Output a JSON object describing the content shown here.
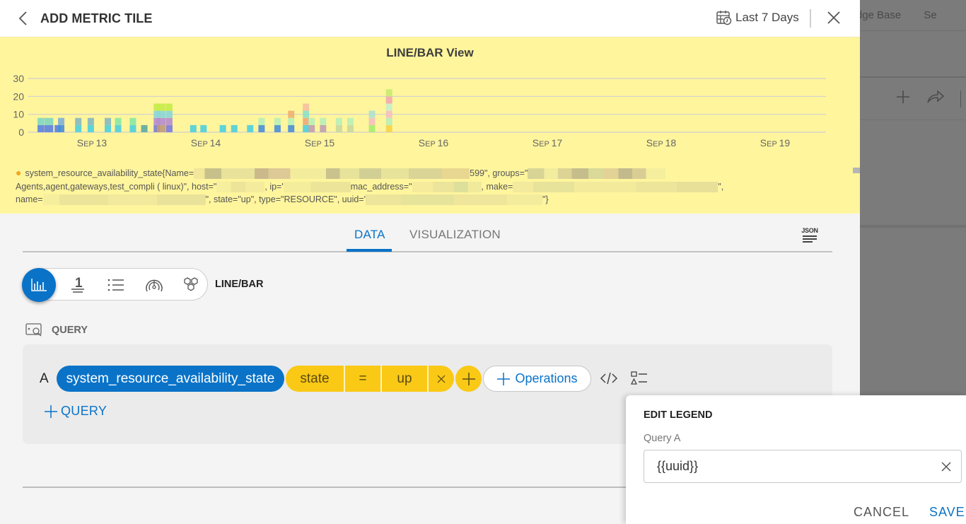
{
  "background_app": {
    "nav_items": [
      "owledge Base",
      "Se"
    ],
    "toolbar_icons": [
      "plus-icon",
      "share-icon"
    ]
  },
  "header": {
    "title": "ADD METRIC TILE",
    "time_range": "Last 7 Days",
    "back_icon": "chevron-left-icon",
    "calendar_icon": "calendar-clock-icon",
    "close_icon": "close-icon"
  },
  "preview": {
    "chart_title": "LINE/BAR View",
    "legend_lines": [
      {
        "prefix": "system_resource_availability_state{Name=",
        "mid1": "599\", groups=\"",
        "mid2": ""
      },
      {
        "prefix": "Agents,agent,gateways,test_compli ( linux)\", host=\"",
        "mid1": ", ip='",
        "mid2": "mac_address=\"",
        "mid3": ", make=",
        "end": "\","
      },
      {
        "prefix": "name=",
        "mid1": "\", state=\"up\", type=\"RESOURCE\", uuid='",
        "end": "\"}"
      }
    ]
  },
  "chart_data": {
    "type": "bar",
    "title": "LINE/BAR View",
    "xlabel": "",
    "ylabel": "",
    "ylim": [
      0,
      30
    ],
    "yticks": [
      0,
      10,
      20,
      30
    ],
    "xticks": [
      "Sep 13",
      "Sep 14",
      "Sep 15",
      "Sep 16",
      "Sep 17",
      "Sep 18",
      "Sep 19"
    ],
    "grid": true,
    "stacked": true,
    "note": "Stacked bars of series count per time bucket; approximate heights read from gridlines",
    "bars": [
      {
        "day": 12.55,
        "segments": [
          {
            "value": 4,
            "color": "#5c7fe0"
          },
          {
            "value": 4,
            "color": "#7fd6c2"
          }
        ]
      },
      {
        "day": 12.62,
        "segments": [
          {
            "value": 4,
            "color": "#5c7fe0"
          },
          {
            "value": 4,
            "color": "#7fd6c2"
          }
        ]
      },
      {
        "day": 12.7,
        "segments": [
          {
            "value": 4,
            "color": "#5c7fe0"
          }
        ]
      },
      {
        "day": 12.73,
        "segments": [
          {
            "value": 4,
            "color": "#4a8ed8"
          },
          {
            "value": 4,
            "color": "#7fb0d8"
          }
        ]
      },
      {
        "day": 12.88,
        "segments": [
          {
            "value": 4,
            "color": "#4ccfdf"
          },
          {
            "value": 4,
            "color": "#86b8c3"
          }
        ]
      },
      {
        "day": 12.99,
        "segments": [
          {
            "value": 4,
            "color": "#4ccfdf"
          },
          {
            "value": 4,
            "color": "#86b8c3"
          }
        ]
      },
      {
        "day": 13.14,
        "segments": [
          {
            "value": 4,
            "color": "#4ccfdf"
          },
          {
            "value": 4,
            "color": "#86b8c3"
          }
        ]
      },
      {
        "day": 13.23,
        "segments": [
          {
            "value": 4,
            "color": "#4ccfdf"
          },
          {
            "value": 4,
            "color": "#86e8a6"
          }
        ]
      },
      {
        "day": 13.36,
        "segments": [
          {
            "value": 4,
            "color": "#4ccfdf"
          },
          {
            "value": 4,
            "color": "#86e8a6"
          }
        ]
      },
      {
        "day": 13.46,
        "segments": [
          {
            "value": 4,
            "color": "#5fa8a0"
          }
        ]
      },
      {
        "day": 13.57,
        "segments": [
          {
            "value": 4,
            "color": "#7a7ae0"
          },
          {
            "value": 4,
            "color": "#b58ccf"
          },
          {
            "value": 4,
            "color": "#8bd6d6"
          },
          {
            "value": 4,
            "color": "#c7ec4a"
          }
        ]
      },
      {
        "day": 13.61,
        "segments": [
          {
            "value": 4,
            "color": "#c09a7a"
          },
          {
            "value": 4,
            "color": "#b58ccf"
          },
          {
            "value": 4,
            "color": "#8bd6d6"
          },
          {
            "value": 4,
            "color": "#c7ec4a"
          }
        ]
      },
      {
        "day": 13.68,
        "segments": [
          {
            "value": 4,
            "color": "#7a7ae0"
          },
          {
            "value": 4,
            "color": "#b58ccf"
          },
          {
            "value": 4,
            "color": "#8bd6d6"
          },
          {
            "value": 4,
            "color": "#c7ec4a"
          }
        ]
      },
      {
        "day": 13.89,
        "segments": [
          {
            "value": 4,
            "color": "#4ccfdf"
          }
        ]
      },
      {
        "day": 13.98,
        "segments": [
          {
            "value": 4,
            "color": "#4ccfdf"
          }
        ]
      },
      {
        "day": 14.15,
        "segments": [
          {
            "value": 4,
            "color": "#4ccfdf"
          }
        ]
      },
      {
        "day": 14.25,
        "segments": [
          {
            "value": 4,
            "color": "#4ccfdf"
          }
        ]
      },
      {
        "day": 14.39,
        "segments": [
          {
            "value": 4,
            "color": "#4ccfdf"
          }
        ]
      },
      {
        "day": 14.49,
        "segments": [
          {
            "value": 4,
            "color": "#4a8ed8"
          },
          {
            "value": 4,
            "color": "#b8f0b8"
          }
        ]
      },
      {
        "day": 14.63,
        "segments": [
          {
            "value": 4,
            "color": "#4a8ed8"
          },
          {
            "value": 4,
            "color": "#b8f0b8"
          }
        ]
      },
      {
        "day": 14.75,
        "segments": [
          {
            "value": 4,
            "color": "#4a8ed8"
          },
          {
            "value": 4,
            "color": "#b8f0b8"
          },
          {
            "value": 4,
            "color": "#f0b070"
          }
        ]
      },
      {
        "day": 14.88,
        "segments": [
          {
            "value": 4,
            "color": "#4ccfdf"
          },
          {
            "value": 4,
            "color": "#f0a878"
          },
          {
            "value": 4,
            "color": "#8be0c8"
          },
          {
            "value": 4,
            "color": "#f7c0a0"
          }
        ]
      },
      {
        "day": 14.93,
        "segments": [
          {
            "value": 4,
            "color": "#c0a0b0"
          },
          {
            "value": 4,
            "color": "#b8f0b8"
          }
        ]
      },
      {
        "day": 15.03,
        "segments": [
          {
            "value": 4,
            "color": "#c0a0b0"
          },
          {
            "value": 4,
            "color": "#b8f0b8"
          }
        ]
      },
      {
        "day": 15.17,
        "segments": [
          {
            "value": 4,
            "color": "#c8d8a0"
          },
          {
            "value": 4,
            "color": "#b8f0b8"
          }
        ]
      },
      {
        "day": 15.27,
        "segments": [
          {
            "value": 4,
            "color": "#c8d8a0"
          },
          {
            "value": 4,
            "color": "#b8f0b8"
          }
        ]
      },
      {
        "day": 15.46,
        "segments": [
          {
            "value": 4,
            "color": "#a8ec70"
          },
          {
            "value": 4,
            "color": "#f4c0c0"
          },
          {
            "value": 4,
            "color": "#b0e0d0"
          }
        ]
      },
      {
        "day": 15.61,
        "segments": [
          {
            "value": 4,
            "color": "#f5d44a"
          },
          {
            "value": 4,
            "color": "#b8f0b8"
          },
          {
            "value": 4,
            "color": "#f4c0c0"
          },
          {
            "value": 4,
            "color": "#c8f0c8"
          },
          {
            "value": 4,
            "color": "#f4a8b0"
          },
          {
            "value": 4,
            "color": "#c7ec70"
          }
        ]
      }
    ]
  },
  "tabs": [
    {
      "label": "DATA",
      "active": true
    },
    {
      "label": "VISUALIZATION",
      "active": false
    }
  ],
  "json_button": {
    "label": "JSON"
  },
  "viz_types": [
    {
      "name": "line-bar",
      "icon": "bar-chart-icon",
      "active": true
    },
    {
      "name": "single-value",
      "icon": "number-one-icon",
      "active": false
    },
    {
      "name": "list",
      "icon": "list-icon",
      "active": false
    },
    {
      "name": "gauge",
      "icon": "gauge-icon",
      "active": false
    },
    {
      "name": "honeycomb",
      "icon": "honeycomb-icon",
      "active": false
    }
  ],
  "viz_selected_label": "LINE/BAR",
  "query_section": {
    "header": "QUERY",
    "queries": [
      {
        "letter": "A",
        "metric": "system_resource_availability_state",
        "filter": {
          "key": "state",
          "operator": "=",
          "value": "up"
        },
        "operations_label": "Operations"
      }
    ],
    "add_query_label": "QUERY"
  },
  "edit_legend": {
    "title": "EDIT LEGEND",
    "field_label": "Query A",
    "value": "{{uuid}}",
    "cancel_label": "CANCEL",
    "save_label": "SAVE"
  },
  "colors": {
    "accent": "#0a73c8",
    "filter": "#f9c916",
    "preview_bg": "#fff59d"
  }
}
